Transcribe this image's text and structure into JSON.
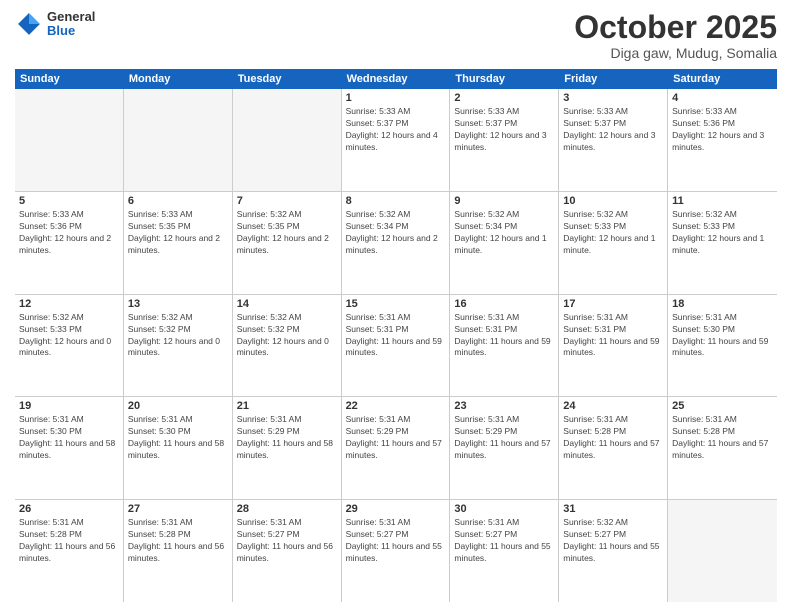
{
  "logo": {
    "general": "General",
    "blue": "Blue"
  },
  "title": "October 2025",
  "subtitle": "Diga gaw, Mudug, Somalia",
  "weekdays": [
    "Sunday",
    "Monday",
    "Tuesday",
    "Wednesday",
    "Thursday",
    "Friday",
    "Saturday"
  ],
  "weeks": [
    [
      {
        "day": "",
        "sunrise": "",
        "sunset": "",
        "daylight": "",
        "empty": true
      },
      {
        "day": "",
        "sunrise": "",
        "sunset": "",
        "daylight": "",
        "empty": true
      },
      {
        "day": "",
        "sunrise": "",
        "sunset": "",
        "daylight": "",
        "empty": true
      },
      {
        "day": "1",
        "sunrise": "Sunrise: 5:33 AM",
        "sunset": "Sunset: 5:37 PM",
        "daylight": "Daylight: 12 hours and 4 minutes.",
        "empty": false
      },
      {
        "day": "2",
        "sunrise": "Sunrise: 5:33 AM",
        "sunset": "Sunset: 5:37 PM",
        "daylight": "Daylight: 12 hours and 3 minutes.",
        "empty": false
      },
      {
        "day": "3",
        "sunrise": "Sunrise: 5:33 AM",
        "sunset": "Sunset: 5:37 PM",
        "daylight": "Daylight: 12 hours and 3 minutes.",
        "empty": false
      },
      {
        "day": "4",
        "sunrise": "Sunrise: 5:33 AM",
        "sunset": "Sunset: 5:36 PM",
        "daylight": "Daylight: 12 hours and 3 minutes.",
        "empty": false
      }
    ],
    [
      {
        "day": "5",
        "sunrise": "Sunrise: 5:33 AM",
        "sunset": "Sunset: 5:36 PM",
        "daylight": "Daylight: 12 hours and 2 minutes.",
        "empty": false
      },
      {
        "day": "6",
        "sunrise": "Sunrise: 5:33 AM",
        "sunset": "Sunset: 5:35 PM",
        "daylight": "Daylight: 12 hours and 2 minutes.",
        "empty": false
      },
      {
        "day": "7",
        "sunrise": "Sunrise: 5:32 AM",
        "sunset": "Sunset: 5:35 PM",
        "daylight": "Daylight: 12 hours and 2 minutes.",
        "empty": false
      },
      {
        "day": "8",
        "sunrise": "Sunrise: 5:32 AM",
        "sunset": "Sunset: 5:34 PM",
        "daylight": "Daylight: 12 hours and 2 minutes.",
        "empty": false
      },
      {
        "day": "9",
        "sunrise": "Sunrise: 5:32 AM",
        "sunset": "Sunset: 5:34 PM",
        "daylight": "Daylight: 12 hours and 1 minute.",
        "empty": false
      },
      {
        "day": "10",
        "sunrise": "Sunrise: 5:32 AM",
        "sunset": "Sunset: 5:33 PM",
        "daylight": "Daylight: 12 hours and 1 minute.",
        "empty": false
      },
      {
        "day": "11",
        "sunrise": "Sunrise: 5:32 AM",
        "sunset": "Sunset: 5:33 PM",
        "daylight": "Daylight: 12 hours and 1 minute.",
        "empty": false
      }
    ],
    [
      {
        "day": "12",
        "sunrise": "Sunrise: 5:32 AM",
        "sunset": "Sunset: 5:33 PM",
        "daylight": "Daylight: 12 hours and 0 minutes.",
        "empty": false
      },
      {
        "day": "13",
        "sunrise": "Sunrise: 5:32 AM",
        "sunset": "Sunset: 5:32 PM",
        "daylight": "Daylight: 12 hours and 0 minutes.",
        "empty": false
      },
      {
        "day": "14",
        "sunrise": "Sunrise: 5:32 AM",
        "sunset": "Sunset: 5:32 PM",
        "daylight": "Daylight: 12 hours and 0 minutes.",
        "empty": false
      },
      {
        "day": "15",
        "sunrise": "Sunrise: 5:31 AM",
        "sunset": "Sunset: 5:31 PM",
        "daylight": "Daylight: 11 hours and 59 minutes.",
        "empty": false
      },
      {
        "day": "16",
        "sunrise": "Sunrise: 5:31 AM",
        "sunset": "Sunset: 5:31 PM",
        "daylight": "Daylight: 11 hours and 59 minutes.",
        "empty": false
      },
      {
        "day": "17",
        "sunrise": "Sunrise: 5:31 AM",
        "sunset": "Sunset: 5:31 PM",
        "daylight": "Daylight: 11 hours and 59 minutes.",
        "empty": false
      },
      {
        "day": "18",
        "sunrise": "Sunrise: 5:31 AM",
        "sunset": "Sunset: 5:30 PM",
        "daylight": "Daylight: 11 hours and 59 minutes.",
        "empty": false
      }
    ],
    [
      {
        "day": "19",
        "sunrise": "Sunrise: 5:31 AM",
        "sunset": "Sunset: 5:30 PM",
        "daylight": "Daylight: 11 hours and 58 minutes.",
        "empty": false
      },
      {
        "day": "20",
        "sunrise": "Sunrise: 5:31 AM",
        "sunset": "Sunset: 5:30 PM",
        "daylight": "Daylight: 11 hours and 58 minutes.",
        "empty": false
      },
      {
        "day": "21",
        "sunrise": "Sunrise: 5:31 AM",
        "sunset": "Sunset: 5:29 PM",
        "daylight": "Daylight: 11 hours and 58 minutes.",
        "empty": false
      },
      {
        "day": "22",
        "sunrise": "Sunrise: 5:31 AM",
        "sunset": "Sunset: 5:29 PM",
        "daylight": "Daylight: 11 hours and 57 minutes.",
        "empty": false
      },
      {
        "day": "23",
        "sunrise": "Sunrise: 5:31 AM",
        "sunset": "Sunset: 5:29 PM",
        "daylight": "Daylight: 11 hours and 57 minutes.",
        "empty": false
      },
      {
        "day": "24",
        "sunrise": "Sunrise: 5:31 AM",
        "sunset": "Sunset: 5:28 PM",
        "daylight": "Daylight: 11 hours and 57 minutes.",
        "empty": false
      },
      {
        "day": "25",
        "sunrise": "Sunrise: 5:31 AM",
        "sunset": "Sunset: 5:28 PM",
        "daylight": "Daylight: 11 hours and 57 minutes.",
        "empty": false
      }
    ],
    [
      {
        "day": "26",
        "sunrise": "Sunrise: 5:31 AM",
        "sunset": "Sunset: 5:28 PM",
        "daylight": "Daylight: 11 hours and 56 minutes.",
        "empty": false
      },
      {
        "day": "27",
        "sunrise": "Sunrise: 5:31 AM",
        "sunset": "Sunset: 5:28 PM",
        "daylight": "Daylight: 11 hours and 56 minutes.",
        "empty": false
      },
      {
        "day": "28",
        "sunrise": "Sunrise: 5:31 AM",
        "sunset": "Sunset: 5:27 PM",
        "daylight": "Daylight: 11 hours and 56 minutes.",
        "empty": false
      },
      {
        "day": "29",
        "sunrise": "Sunrise: 5:31 AM",
        "sunset": "Sunset: 5:27 PM",
        "daylight": "Daylight: 11 hours and 55 minutes.",
        "empty": false
      },
      {
        "day": "30",
        "sunrise": "Sunrise: 5:31 AM",
        "sunset": "Sunset: 5:27 PM",
        "daylight": "Daylight: 11 hours and 55 minutes.",
        "empty": false
      },
      {
        "day": "31",
        "sunrise": "Sunrise: 5:32 AM",
        "sunset": "Sunset: 5:27 PM",
        "daylight": "Daylight: 11 hours and 55 minutes.",
        "empty": false
      },
      {
        "day": "",
        "sunrise": "",
        "sunset": "",
        "daylight": "",
        "empty": true
      }
    ]
  ]
}
